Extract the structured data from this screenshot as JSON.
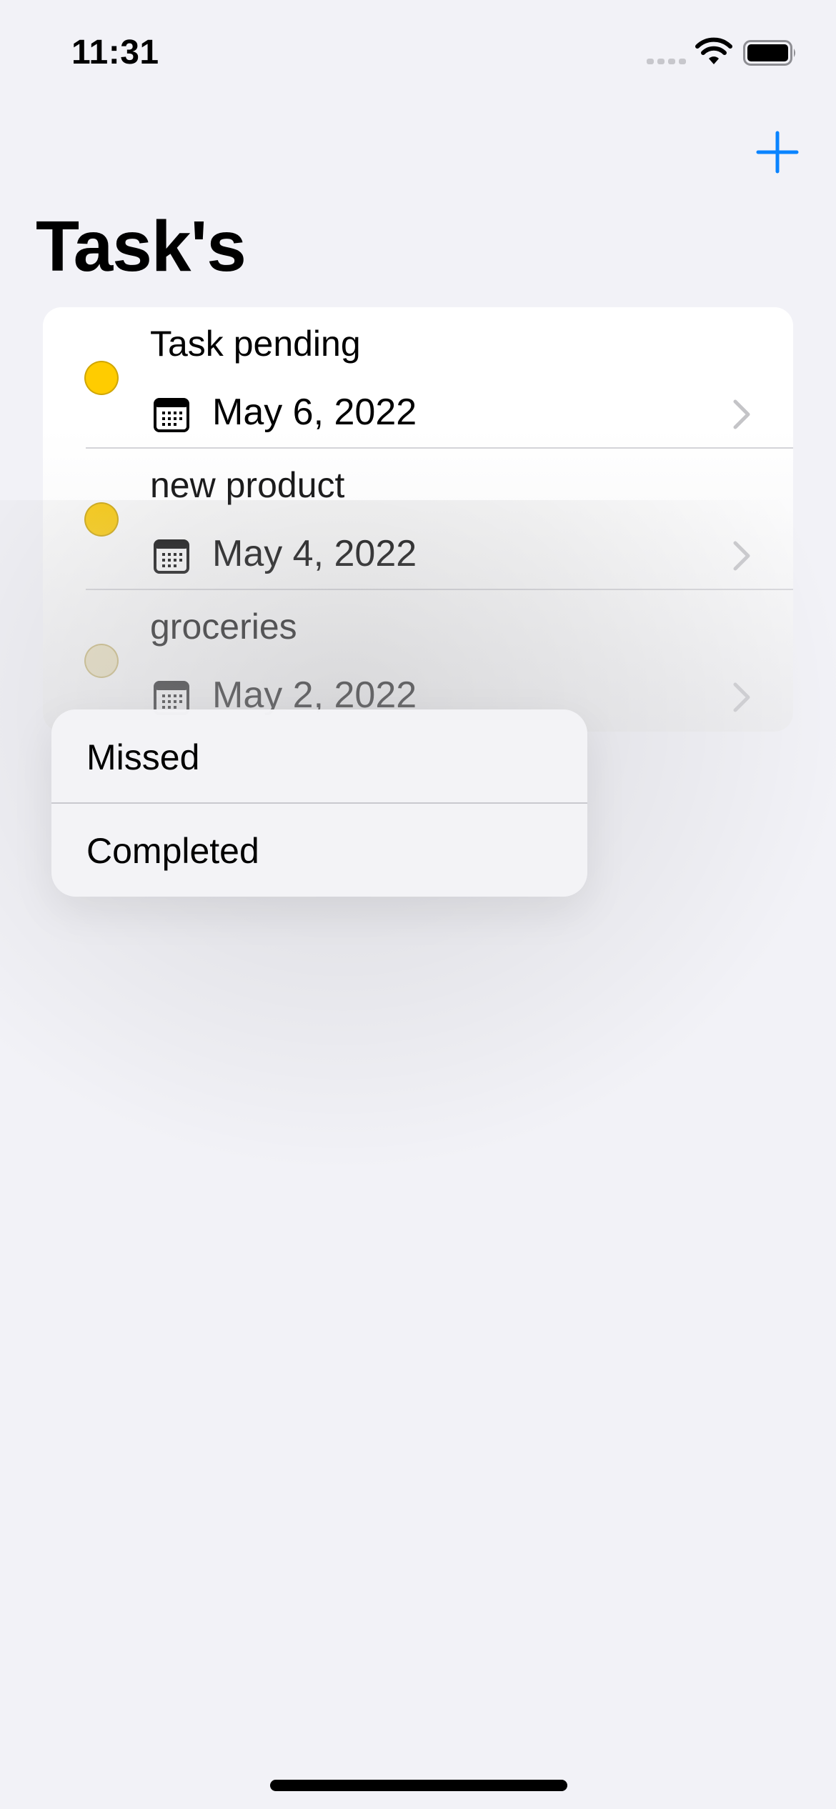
{
  "status_bar": {
    "time": "11:31"
  },
  "nav": {
    "title": "Task's",
    "add_icon": "plus-icon",
    "accent_color": "#0a84ff"
  },
  "tasks": [
    {
      "title": "Task pending",
      "date": "May 6, 2022",
      "status_color": "#ffcc00"
    },
    {
      "title": "new product",
      "date": "May 4, 2022",
      "status_color": "#ffcc00"
    },
    {
      "title": "groceries",
      "date": "May 2, 2022",
      "status_color": "#ede2b8"
    }
  ],
  "context_menu": {
    "items": [
      {
        "label": "Missed"
      },
      {
        "label": "Completed"
      }
    ]
  }
}
